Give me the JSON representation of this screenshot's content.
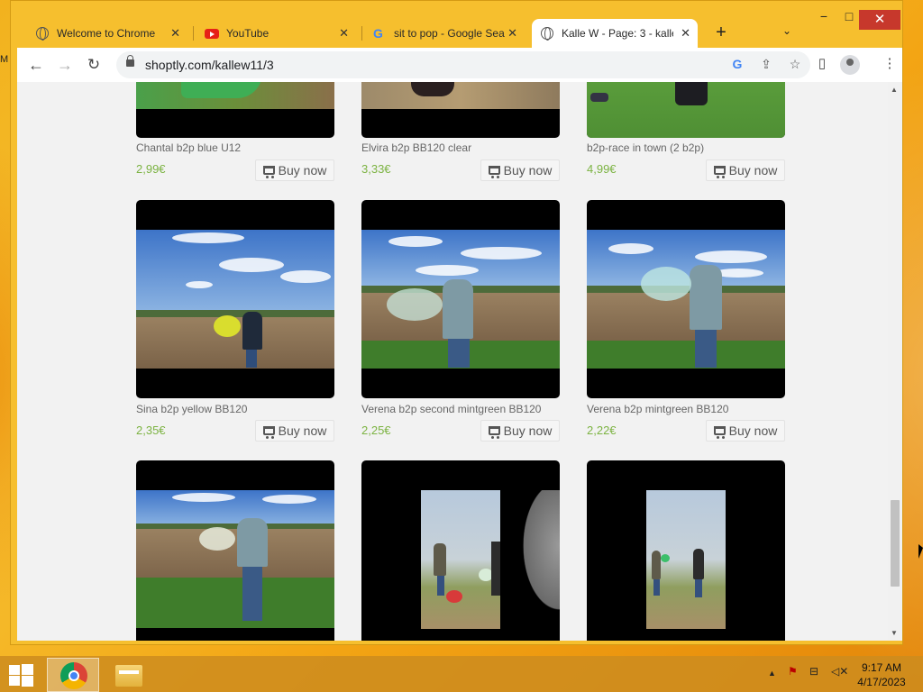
{
  "browser": {
    "tabs": [
      {
        "title": "Welcome to Chrome",
        "icon": "globe-icon",
        "active": false
      },
      {
        "title": "YouTube",
        "icon": "youtube-icon",
        "active": false
      },
      {
        "title": "sit to pop - Google Sea",
        "icon": "google-icon",
        "active": false
      },
      {
        "title": "Kalle W - Page: 3 - kalle",
        "icon": "globe-icon",
        "active": true
      }
    ],
    "new_tab_label": "+",
    "tab_search_label": "⌄",
    "window_controls": {
      "minimize": "−",
      "maximize": "□",
      "close": "✕"
    },
    "url": "shoptly.com/kallew11/3"
  },
  "shop": {
    "buy_label": "Buy now",
    "rows": [
      [
        {
          "title": "Chantal b2p blue U12",
          "price": "2,99€"
        },
        {
          "title": "Elvira b2p BB120 clear",
          "price": "3,33€"
        },
        {
          "title": "b2p-race in town (2 b2p)",
          "price": "4,99€"
        }
      ],
      [
        {
          "title": "Sina b2p yellow BB120",
          "price": "2,35€"
        },
        {
          "title": "Verena b2p second mintgreen BB120",
          "price": "2,25€"
        },
        {
          "title": "Verena b2p mintgreen BB120",
          "price": "2,22€"
        }
      ],
      [
        {
          "title": "",
          "price": ""
        },
        {
          "title": "",
          "price": ""
        },
        {
          "title": "",
          "price": ""
        }
      ]
    ]
  },
  "taskbar": {
    "time": "9:17 AM",
    "date": "4/17/2023"
  },
  "colors": {
    "price": "#7cb342",
    "desktop": "#f6c030",
    "close_button": "#c7382c"
  }
}
